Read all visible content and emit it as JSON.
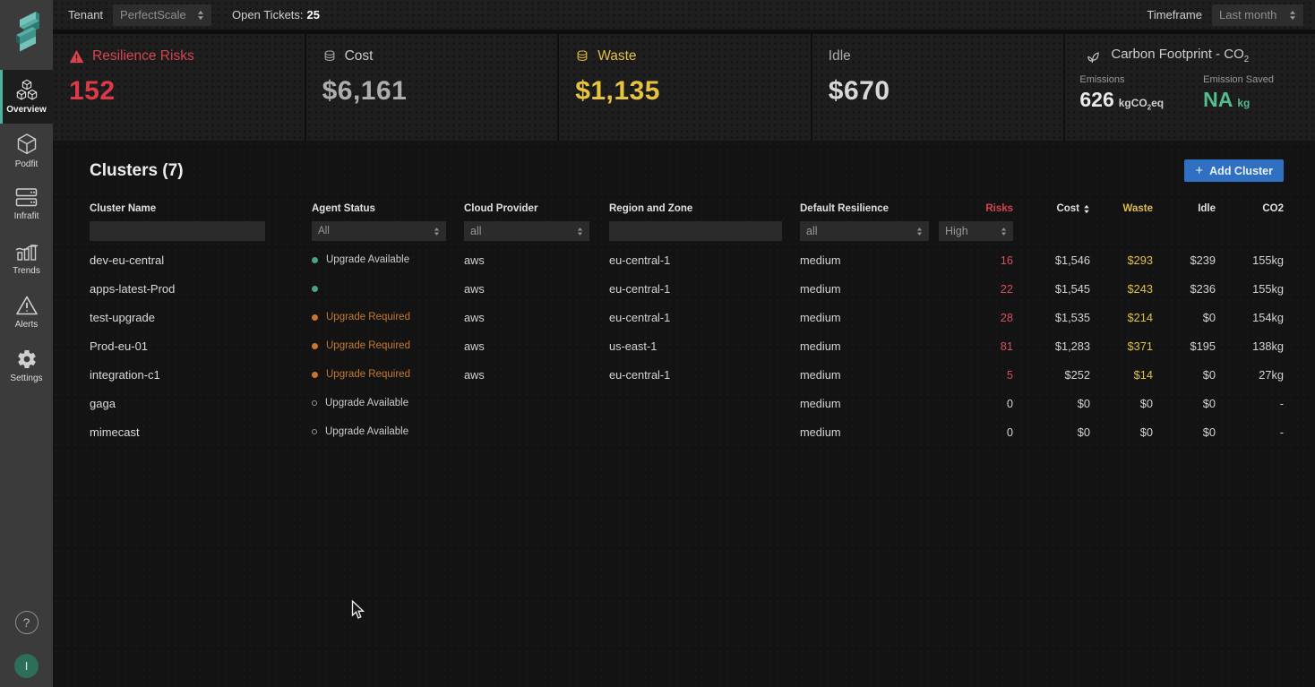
{
  "colors": {
    "accent_teal": "#4cb3a0",
    "risk_red": "#d8444f",
    "waste_yellow": "#e3c04a",
    "saved_green": "#53bd8f",
    "upgrade_orange": "#c8772f",
    "add_button_blue": "#2f70c2"
  },
  "topbar": {
    "tenant_label": "Tenant",
    "tenant_value": "PerfectScale",
    "open_tickets_label": "Open Tickets:",
    "open_tickets_value": "25",
    "timeframe_label": "Timeframe",
    "timeframe_value": "Last month"
  },
  "sidebar": {
    "items": [
      {
        "label": "Overview"
      },
      {
        "label": "Podfit"
      },
      {
        "label": "Infrafit"
      },
      {
        "label": "Trends"
      },
      {
        "label": "Alerts"
      },
      {
        "label": "Settings"
      }
    ],
    "help_label": "?",
    "avatar_label": "I"
  },
  "cards": {
    "resilience": {
      "title": "Resilience Risks",
      "value": "152"
    },
    "cost": {
      "title": "Cost",
      "value": "$6,161"
    },
    "waste": {
      "title": "Waste",
      "value": "$1,135"
    },
    "idle": {
      "title": "Idle",
      "value": "$670"
    },
    "carbon": {
      "title_main": "Carbon Footprint - CO",
      "title_sub": "2",
      "emissions_label": "Emissions",
      "emissions_value": "626",
      "emissions_unit_pre": "kgCO",
      "emissions_unit_sub": "2",
      "emissions_unit_post": "eq",
      "saved_label": "Emission Saved",
      "saved_value": "NA",
      "saved_unit": "kg"
    }
  },
  "clusters": {
    "title": "Clusters (7)",
    "add_button_label": "Add Cluster",
    "plus_glyph": "+",
    "columns": [
      "Cluster Name",
      "Agent Status",
      "Cloud Provider",
      "Region and Zone",
      "Default Resilience",
      "Risks",
      "Cost",
      "Waste",
      "Idle",
      "CO2"
    ],
    "filters": {
      "cluster_name_value": "",
      "agent_status": "All",
      "cloud_provider": "all",
      "region_value": "",
      "default_resilience": "all",
      "risks": "High"
    },
    "rows": [
      {
        "name": "dev-eu-central",
        "agent_state": "ok",
        "agent_label": "Upgrade Available",
        "cloud": "aws",
        "region": "eu-central-1",
        "resilience": "medium",
        "risks": "16",
        "cost": "$1,546",
        "waste": "$293",
        "idle": "$239",
        "co2": "155kg"
      },
      {
        "name": "apps-latest-Prod",
        "agent_state": "ok",
        "agent_label": "",
        "cloud": "aws",
        "region": "eu-central-1",
        "resilience": "medium",
        "risks": "22",
        "cost": "$1,545",
        "waste": "$243",
        "idle": "$236",
        "co2": "155kg"
      },
      {
        "name": "test-upgrade",
        "agent_state": "warn",
        "agent_label": "Upgrade Required",
        "cloud": "aws",
        "region": "eu-central-1",
        "resilience": "medium",
        "risks": "28",
        "cost": "$1,535",
        "waste": "$214",
        "idle": "$0",
        "co2": "154kg"
      },
      {
        "name": "Prod-eu-01",
        "agent_state": "warn",
        "agent_label": "Upgrade Required",
        "cloud": "aws",
        "region": "us-east-1",
        "resilience": "medium",
        "risks": "81",
        "cost": "$1,283",
        "waste": "$371",
        "idle": "$195",
        "co2": "138kg"
      },
      {
        "name": "integration-c1",
        "agent_state": "warn",
        "agent_label": "Upgrade Required",
        "cloud": "aws",
        "region": "eu-central-1",
        "resilience": "medium",
        "risks": "5",
        "cost": "$252",
        "waste": "$14",
        "idle": "$0",
        "co2": "27kg"
      },
      {
        "name": "gaga",
        "agent_state": "off",
        "agent_label": "Upgrade Available",
        "cloud": "",
        "region": "",
        "resilience": "medium",
        "risks": "0",
        "cost": "$0",
        "waste": "$0",
        "idle": "$0",
        "co2": "-"
      },
      {
        "name": "mimecast",
        "agent_state": "off",
        "agent_label": "Upgrade Available",
        "cloud": "",
        "region": "",
        "resilience": "medium",
        "risks": "0",
        "cost": "$0",
        "waste": "$0",
        "idle": "$0",
        "co2": "-"
      }
    ]
  }
}
